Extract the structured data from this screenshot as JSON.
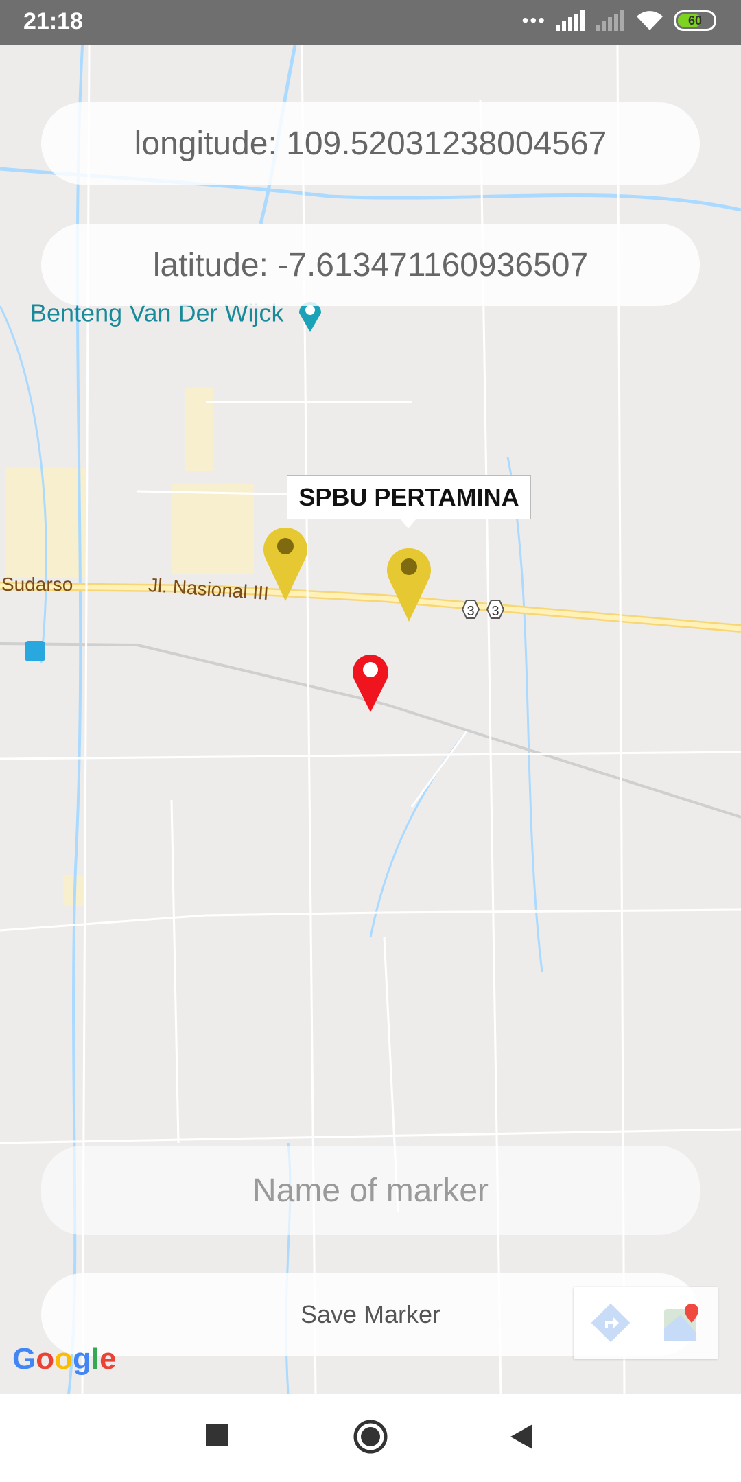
{
  "status": {
    "time": "21:18",
    "battery": "60"
  },
  "coords": {
    "longitude": "longitude: 109.52031238004567",
    "latitude": "latitude: -7.613471160936507"
  },
  "map": {
    "labels": {
      "benteng": "Benteng Van Der Wijck",
      "sudarso": "Sudarso",
      "nasional": "Jl. Nasional III",
      "route_shield_1": "3",
      "route_shield_2": "3"
    },
    "infowindow": "SPBU PERTAMINA",
    "google": {
      "G": "G",
      "o1": "o",
      "o2": "o",
      "g": "g",
      "l": "l",
      "e": "e"
    },
    "colors": {
      "accent_marker_red": "#f0141e",
      "fuel_marker_yellow": "#e6c832",
      "water": "#aadaff",
      "road": "#fff1b8"
    }
  },
  "form": {
    "name_placeholder": "Name of marker",
    "save_label": "Save Marker"
  },
  "icons": {
    "directions": "directions-icon",
    "open_in_maps": "google-maps-icon",
    "nav_recents": "square-recents-icon",
    "nav_home": "circle-home-icon",
    "nav_back": "triangle-back-icon"
  }
}
